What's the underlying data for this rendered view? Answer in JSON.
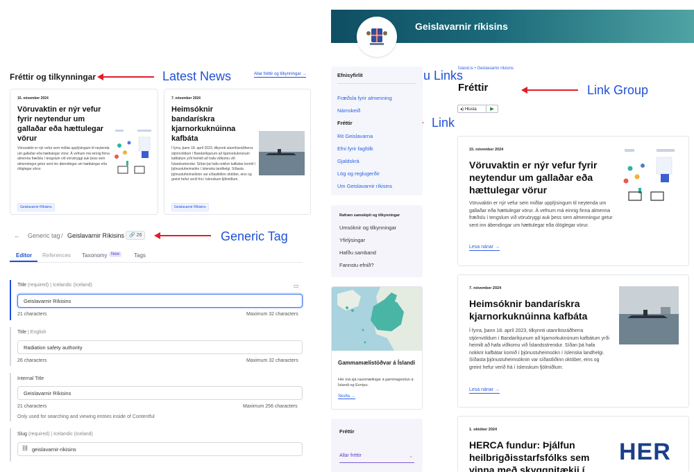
{
  "news": {
    "title": "Fréttir og tilkynningar",
    "all_link": "Allar fréttir og tilkynningar",
    "cards": [
      {
        "date": "15. nóvember 2024",
        "title": "Vöruvaktin er nýr vefur fyrir neytendur um gallaðar eða hættulegar vörur",
        "text": "Vöruvaktin er nýr vefur sem miðlar upplýsingum til neytenda um gallaðar eða hættulegar vörur. Á vefnum má einnig finna almenna fræðslu í tengslum við vöruöryggi auk þess sem almenningur getur sent inn ábendingar um hættulegar eða ólöglegar vörur.",
        "tag": "Geislavarnir Ríkisins"
      },
      {
        "date": "7. nóvember 2024",
        "title": "Heimsóknir bandarískra kjarnorkuknúinna kafbáta",
        "text": "Í fyrra, þann 18. apríl 2023, tilkynnti utanríkisráðherra stjórnvöldum í Bandaríkjunum að kjarnorkuknúnum kafbátum yrði heimilt að hafa viðkomu við Íslandsstrendur. Síðan þá hafa nokkrir kafbátar komið í þjónustuheimsókn í íslenska landhelgi. Síðasta þjónustuheimsóknin var síðastliðinn október, eins og greint hefur verið frá í íslenskum fjölmiðlum.",
        "tag": "Geislavarnir Ríkisins"
      }
    ]
  },
  "editor": {
    "breadcrumb_back": "←",
    "crumb_parent": "Generic tag",
    "crumb_current": "Geislavarnir Ríkisins",
    "ref_count": "26",
    "tabs": [
      "Editor",
      "References",
      "Taxonomy",
      "Tags"
    ],
    "new_badge": "New",
    "fields": [
      {
        "label": "Title",
        "qualifier": "(required)",
        "locale": "Icelandic (Iceland)",
        "value": "Geislavarnir Ríkisins",
        "count": "21 characters",
        "max": "Maximum 32 characters"
      },
      {
        "label": "Title",
        "qualifier": "",
        "locale": "English",
        "value": "Radiation safety authority",
        "count": "26 characters",
        "max": "Maximum 32 characters"
      },
      {
        "label": "Internal Title",
        "qualifier": "",
        "locale": "",
        "value": "Geislavarnir Ríkisins",
        "count": "21 characters",
        "max": "Maximum 256 characters",
        "help": "Only used for searching and viewing entries inside of Contentful"
      },
      {
        "label": "Slug",
        "qualifier": "(required)",
        "locale": "Icelandic (Iceland)",
        "value": "geislavarnir-rikisins"
      }
    ]
  },
  "annotations": {
    "latest_news": "Latest News",
    "generic_tag": "Generic Tag",
    "menu_links": "Menu Links",
    "link": "Link",
    "link_group": "Link Group"
  },
  "site": {
    "name": "Geislavarnir ríkisins",
    "breadcrumb": "Ísland.is  •  Geislavarnir ríkisins",
    "page_title": "Fréttir",
    "listen": "Hlusta",
    "menu_title": "Efnisyfirlit",
    "menu": [
      "Fræðsla fyrir almenning",
      "Námskeið",
      "Fréttir",
      "Rit Geislavarna",
      "Efni fyrir fagfólk",
      "Gjaldskrá",
      "Lög og reglugerðir",
      "Um Geislavarnir ríkisins"
    ],
    "services_title": "Rafræn samskipti og tilkynningar",
    "services": [
      "Umsóknir og tilkynningar",
      "Yfirlýsingar",
      "Hafðu samband",
      "Fannstu efnið?"
    ],
    "map_title": "Gammamælistöðvar á Íslandi",
    "map_text": "Hér má sjá raunmælingar á gammageislun á Íslandi og Evrópu.",
    "map_link": "Skoða",
    "news_box_title": "Fréttir",
    "news_select": "Allar fréttir",
    "read_more": "Lesa nánar",
    "articles": [
      {
        "date": "15. nóvember 2024",
        "title": "Vöruvaktin er nýr vefur fyrir neytendur um gallaðar eða hættulegar vörur",
        "text": "Vöruvaktin er nýr vefur sem miðlar upplýsingum til neytenda um gallaðar eða hættulegar vörur. Á vefnum má einnig finna almenna fræðslu í tengslum við vöruöryggi auk þess sem almenningur getur sent inn ábendingar um hættulegar eða ólöglegar vörur."
      },
      {
        "date": "7. nóvember 2024",
        "title": "Heimsóknir bandarískra kjarnorkuknúinna kafbáta",
        "text": "Í fyrra, þann 18. apríl 2023, tilkynnti utanríkisráðherra stjórnvöldum í Bandaríkjunum að kjarnorkuknúnum kafbátum yrði heimilt að hafa viðkomu við Íslandsstrendur. Síðan þá hafa nokkrir kafbátar komið í þjónustuheimsókn í íslenska landhelgi. Síðasta þjónustuheimsóknin var síðastliðinn október, eins og greint hefur verið frá í íslenskum fjölmiðlum."
      },
      {
        "date": "1. október 2024",
        "title": "HERCA fundur: Þjálfun heilbrigðisstarfsfólks sem vinna með skyggnitækji í",
        "logo_text": "HER"
      }
    ]
  },
  "colors": {
    "accent": "#1d4fd8",
    "annotation_arrow": "#e11d2a",
    "header_dark": "#0f4e63",
    "header_light": "#4fa3a3"
  }
}
